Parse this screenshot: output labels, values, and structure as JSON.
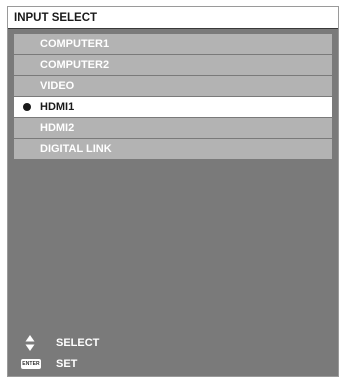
{
  "title": "INPUT SELECT",
  "inputs": [
    {
      "label": "COMPUTER1",
      "selected": false
    },
    {
      "label": "COMPUTER2",
      "selected": false
    },
    {
      "label": "VIDEO",
      "selected": false
    },
    {
      "label": "HDMI1",
      "selected": true
    },
    {
      "label": "HDMI2",
      "selected": false
    },
    {
      "label": "DIGITAL LINK",
      "selected": false
    }
  ],
  "help": {
    "select_label": "SELECT",
    "select_icon": "up-down-arrows-icon",
    "set_label": "SET",
    "set_icon": "enter-key-icon",
    "enter_key_text": "ENTER"
  },
  "colors": {
    "panel": "#7a7a7a",
    "item": "#b3b3b3",
    "selected_item": "#ffffff",
    "text_light": "#ffffff",
    "text_dark": "#1a1a1a"
  }
}
